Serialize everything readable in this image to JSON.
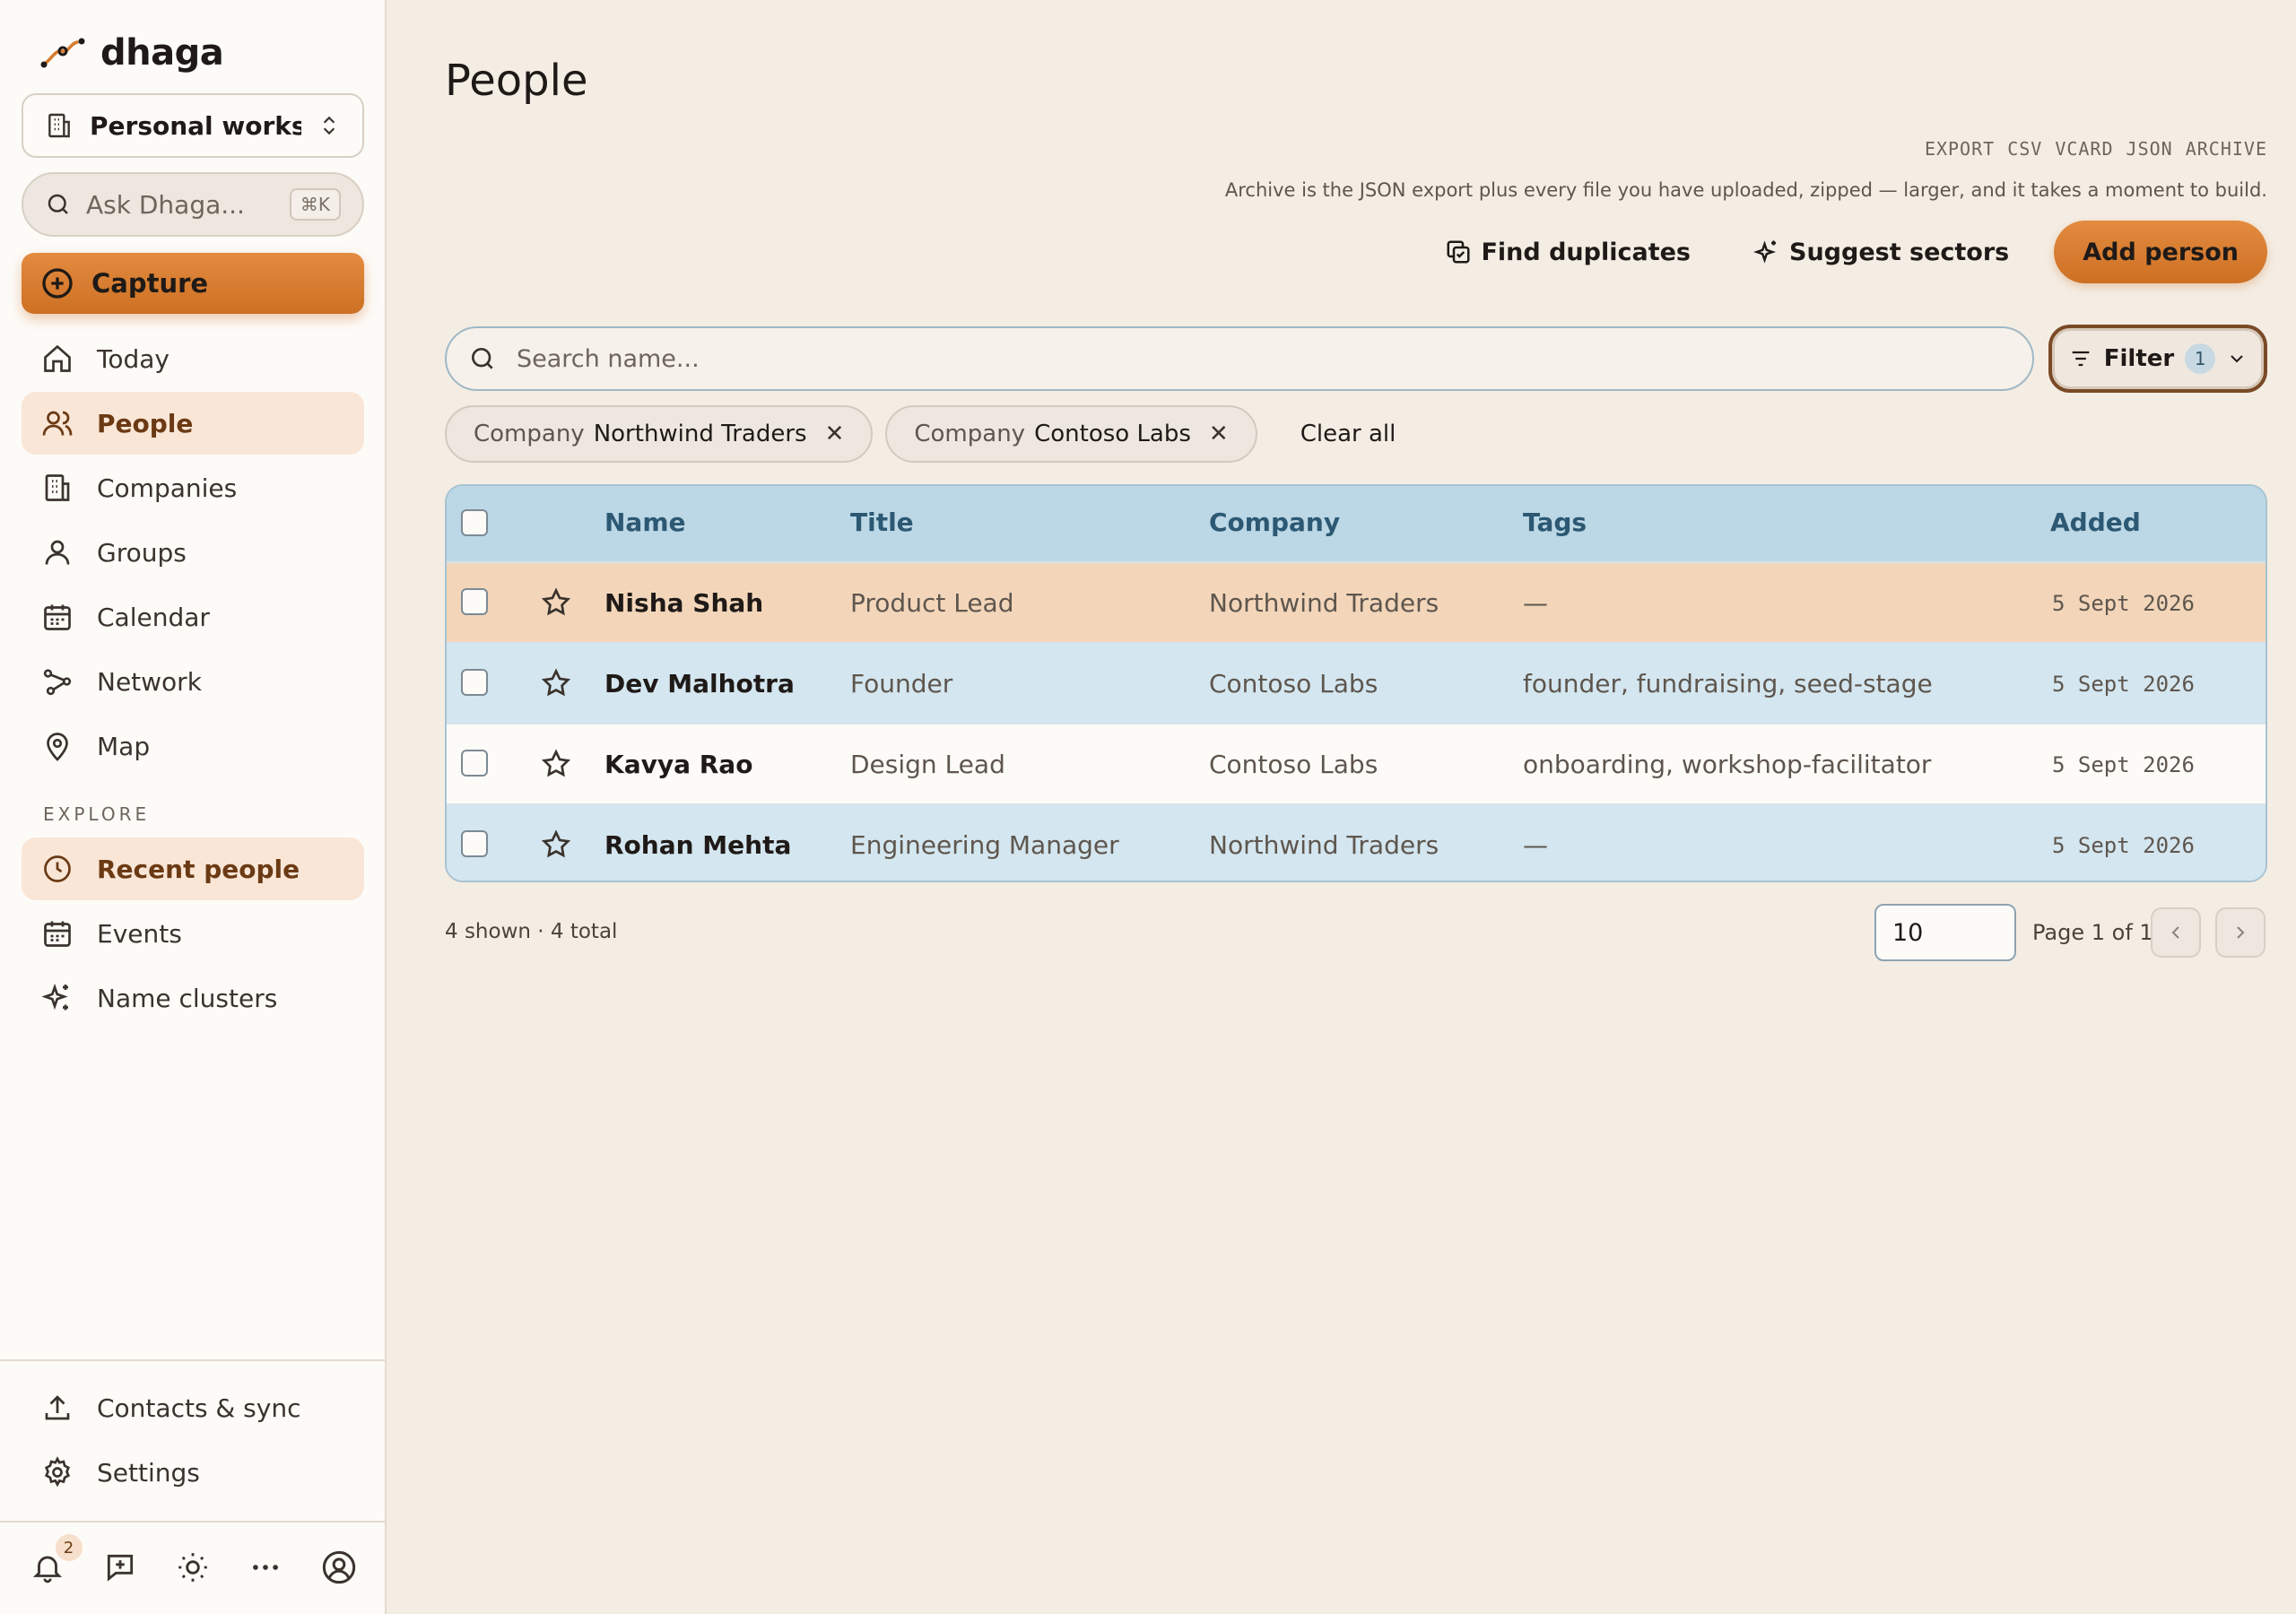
{
  "app": {
    "name": "dhaga"
  },
  "sidebar": {
    "workspace": "Personal works...",
    "ask_placeholder": "Ask Dhaga...",
    "ask_shortcut": "⌘K",
    "capture_label": "Capture",
    "nav": [
      {
        "label": "Today",
        "icon": "home-icon",
        "active": false
      },
      {
        "label": "People",
        "icon": "people-icon",
        "active": true
      },
      {
        "label": "Companies",
        "icon": "building-icon",
        "active": false
      },
      {
        "label": "Groups",
        "icon": "group-icon",
        "active": false
      },
      {
        "label": "Calendar",
        "icon": "calendar-icon",
        "active": false
      },
      {
        "label": "Network",
        "icon": "network-icon",
        "active": false
      },
      {
        "label": "Map",
        "icon": "map-pin-icon",
        "active": false
      }
    ],
    "explore_label": "EXPLORE",
    "explore": [
      {
        "label": "Recent people",
        "icon": "clock-icon",
        "active": true
      },
      {
        "label": "Events",
        "icon": "calendar-icon",
        "active": false
      },
      {
        "label": "Name clusters",
        "icon": "sparkles-icon",
        "active": false
      }
    ],
    "bottom_nav": [
      {
        "label": "Contacts & sync",
        "icon": "upload-icon"
      },
      {
        "label": "Settings",
        "icon": "gear-icon"
      }
    ],
    "notifications_count": "2"
  },
  "main": {
    "title": "People",
    "export": {
      "label": "EXPORT",
      "formats": [
        "CSV",
        "VCARD",
        "JSON",
        "ARCHIVE"
      ]
    },
    "archive_note": "Archive is the JSON export plus every file you have uploaded, zipped — larger, and it takes a moment to build.",
    "actions": {
      "find_duplicates": "Find duplicates",
      "suggest_sectors": "Suggest sectors",
      "add_person": "Add person"
    },
    "search_placeholder": "Search name...",
    "filter": {
      "label": "Filter",
      "count": "1"
    },
    "chips": [
      {
        "key": "Company",
        "value": "Northwind Traders"
      },
      {
        "key": "Company",
        "value": "Contoso Labs"
      }
    ],
    "clear_all": "Clear all",
    "table": {
      "columns": {
        "name": "Name",
        "title": "Title",
        "company": "Company",
        "tags": "Tags",
        "added": "Added"
      },
      "rows": [
        {
          "name": "Nisha Shah",
          "title": "Product Lead",
          "company": "Northwind Traders",
          "tags": "—",
          "added": "5 Sept 2026"
        },
        {
          "name": "Dev Malhotra",
          "title": "Founder",
          "company": "Contoso Labs",
          "tags": "founder, fundraising, seed-stage",
          "added": "5 Sept 2026"
        },
        {
          "name": "Kavya Rao",
          "title": "Design Lead",
          "company": "Contoso Labs",
          "tags": "onboarding, workshop-facilitator",
          "added": "5 Sept 2026"
        },
        {
          "name": "Rohan Mehta",
          "title": "Engineering Manager",
          "company": "Northwind Traders",
          "tags": "—",
          "added": "5 Sept 2026"
        }
      ]
    },
    "footer": {
      "count_text": "4 shown · 4 total",
      "page_size": "10",
      "page_text": "Page 1 of 1"
    }
  },
  "colors": {
    "accent": "#d67a2d",
    "table_header": "#bcd7e5",
    "row_highlight": "#f3d6ba"
  }
}
